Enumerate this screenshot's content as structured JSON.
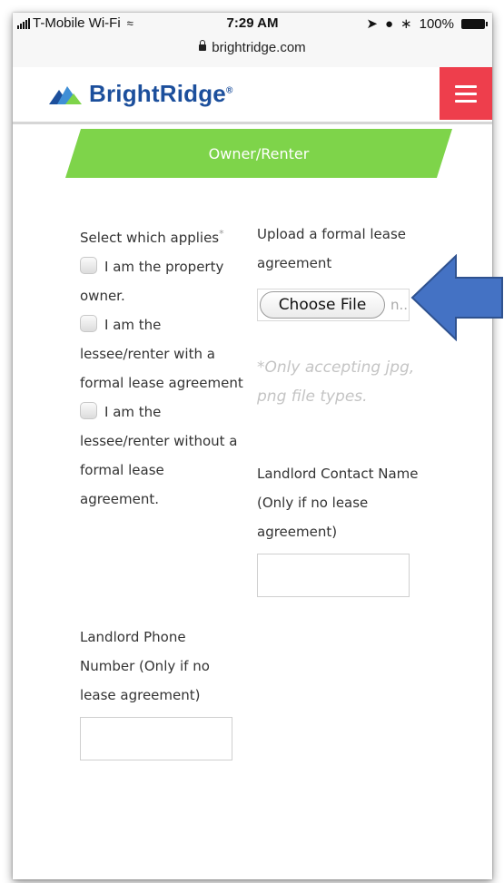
{
  "status_bar": {
    "carrier": "T-Mobile Wi-Fi",
    "time": "7:29 AM",
    "battery": "100%",
    "url": "brightridge.com"
  },
  "header": {
    "logo_text": "BrightRidge",
    "logo_reg": "®",
    "brand_color": "#1c4f9c",
    "menu_color": "#ee3e4c"
  },
  "banner": {
    "title": "Owner/Renter",
    "color": "#7ed44a"
  },
  "form": {
    "select_label": "Select which applies",
    "required_mark": "*",
    "options": [
      {
        "label": "I am the property owner.",
        "checked": false
      },
      {
        "label": "I am the lessee/renter with a formal lease agreement",
        "checked": false
      },
      {
        "label": "I am the lessee/renter without a formal lease agreement.",
        "checked": false
      }
    ],
    "upload_label": "Upload a formal lease agreement",
    "choose_file_label": "Choose File",
    "file_status": "n..",
    "file_hint": "*Only accepting jpg, png file types.",
    "landlord_name_label": "Landlord Contact Name (Only if no lease agreement)",
    "landlord_name_value": "",
    "landlord_phone_label": "Landlord Phone Number (Only if no lease agreement)",
    "landlord_phone_value": ""
  },
  "annotation": {
    "arrow_color": "#4472c4"
  }
}
